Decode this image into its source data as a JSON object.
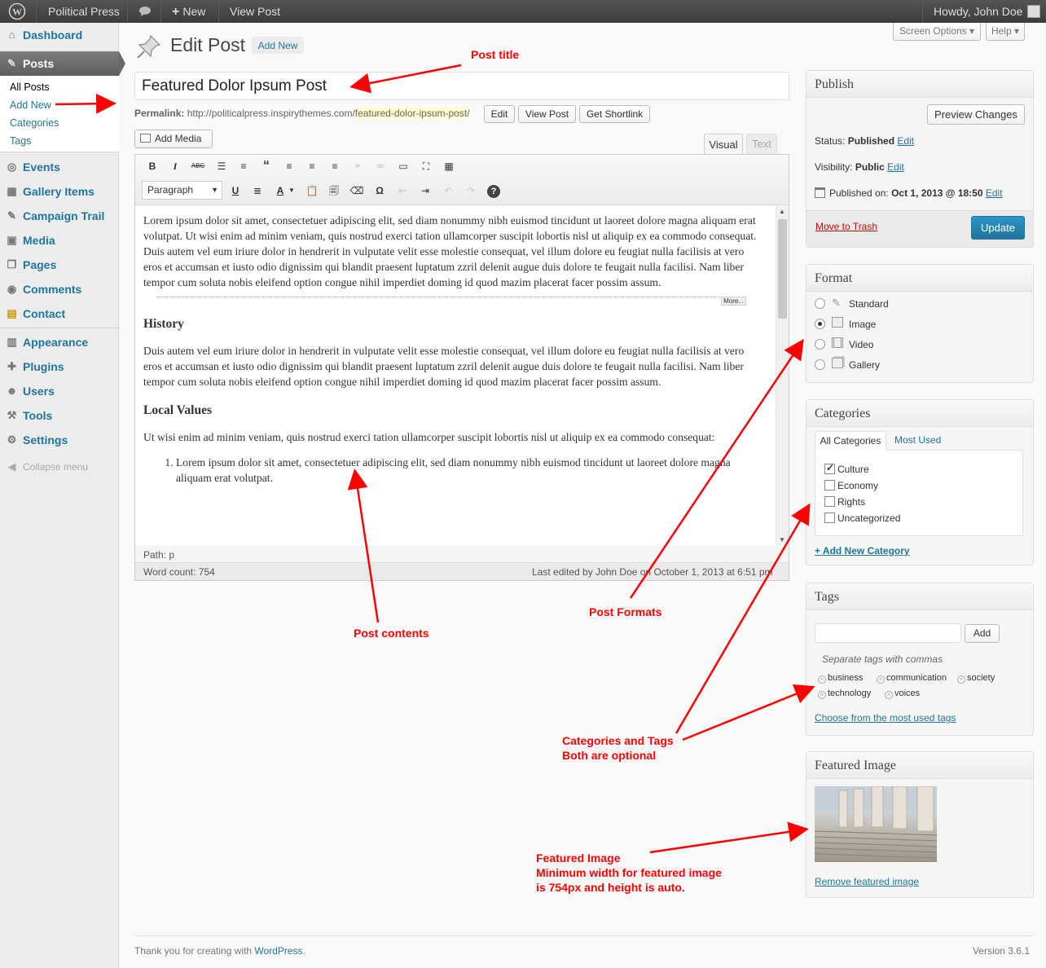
{
  "adminbar": {
    "site": "Political Press",
    "new": "New",
    "view_post": "View Post",
    "howdy": "Howdy, John Doe"
  },
  "sidebar": {
    "items": [
      {
        "label": "Dashboard",
        "icon": "dashboard-icon"
      },
      {
        "label": "Posts",
        "icon": "pin-icon"
      },
      {
        "label": "Events",
        "icon": "events-icon"
      },
      {
        "label": "Gallery Items",
        "icon": "gallery-icon"
      },
      {
        "label": "Campaign Trail",
        "icon": "pin-icon"
      },
      {
        "label": "Media",
        "icon": "media-icon"
      },
      {
        "label": "Pages",
        "icon": "pages-icon"
      },
      {
        "label": "Comments",
        "icon": "comment-icon"
      },
      {
        "label": "Contact",
        "icon": "contact-icon"
      },
      {
        "label": "Appearance",
        "icon": "appearance-icon"
      },
      {
        "label": "Plugins",
        "icon": "plugin-icon"
      },
      {
        "label": "Users",
        "icon": "users-icon"
      },
      {
        "label": "Tools",
        "icon": "tools-icon"
      },
      {
        "label": "Settings",
        "icon": "settings-icon"
      }
    ],
    "posts_sub": [
      "All Posts",
      "Add New",
      "Categories",
      "Tags"
    ],
    "collapse": "Collapse menu"
  },
  "header": {
    "screen_options": "Screen Options",
    "help": "Help",
    "title": "Edit Post",
    "add_new": "Add New"
  },
  "post": {
    "title": "Featured Dolor Ipsum Post",
    "permalink_label": "Permalink:",
    "permalink_base": "http://politicalpress.inspirythemes.com/",
    "permalink_slug": "featured-dolor-ipsum-post",
    "permalink_end": "/",
    "edit": "Edit",
    "view_post": "View Post",
    "get_shortlink": "Get Shortlink"
  },
  "editor": {
    "add_media": "Add Media",
    "tab_visual": "Visual",
    "tab_text": "Text",
    "format": "Paragraph",
    "more": "More...",
    "p1": "Lorem ipsum dolor sit amet, consectetuer adipiscing elit, sed diam nonummy nibh euismod tincidunt ut laoreet dolore magna aliquam erat volutpat. Ut wisi enim ad minim veniam, quis nostrud exerci tation ullamcorper suscipit lobortis nisl ut aliquip ex ea commodo consequat. Duis autem vel eum iriure dolor in hendrerit in vulputate velit esse molestie consequat, vel illum dolore eu feugiat nulla facilisis at vero eros et accumsan et iusto odio dignissim qui blandit praesent luptatum zzril delenit augue duis dolore te feugait nulla facilisi. Nam liber tempor cum soluta nobis eleifend option congue nihil imperdiet doming id quod mazim placerat facer possim assum.",
    "h1": "History",
    "p2": "Duis autem vel eum iriure dolor in hendrerit in vulputate velit esse molestie consequat, vel illum dolore eu feugiat nulla facilisis at vero eros et accumsan et iusto odio dignissim qui blandit praesent luptatum zzril delenit augue duis dolore te feugait nulla facilisi. Nam liber tempor cum soluta nobis eleifend option congue nihil imperdiet doming id quod mazim placerat facer possim assum.",
    "h2": "Local Values",
    "p3": "Ut wisi enim ad minim veniam, quis nostrud exerci tation ullamcorper suscipit lobortis nisl ut aliquip ex ea commodo consequat:",
    "li1": "Lorem ipsum dolor sit amet, consectetuer adipiscing elit, sed diam nonummy nibh euismod tincidunt ut laoreet dolore magna aliquam erat volutpat.",
    "path": "Path: p",
    "word_count": "Word count: 754",
    "last_edited": "Last edited by John Doe on October 1, 2013 at 6:51 pm"
  },
  "publish": {
    "title": "Publish",
    "preview": "Preview Changes",
    "status_label": "Status:",
    "status": "Published",
    "visibility_label": "Visibility:",
    "visibility": "Public",
    "published_label": "Published on:",
    "published_on": "Oct 1, 2013 @ 18:50",
    "edit": "Edit",
    "trash": "Move to Trash",
    "update": "Update"
  },
  "format": {
    "title": "Format",
    "options": [
      "Standard",
      "Image",
      "Video",
      "Gallery"
    ],
    "selected": "Image"
  },
  "categories": {
    "title": "Categories",
    "tab_all": "All Categories",
    "tab_used": "Most Used",
    "items": [
      "Culture",
      "Economy",
      "Rights",
      "Uncategorized"
    ],
    "checked": "Culture",
    "add_new": "+ Add New Category"
  },
  "tags": {
    "title": "Tags",
    "add": "Add",
    "hint": "Separate tags with commas",
    "items": [
      "business",
      "communication",
      "society",
      "technology",
      "voices"
    ],
    "choose": "Choose from the most used tags"
  },
  "featured": {
    "title": "Featured Image",
    "remove": "Remove featured image"
  },
  "annotations": {
    "post_title": "Post title",
    "post_contents": "Post contents",
    "post_formats": "Post Formats",
    "cat_tags_1": "Categories and Tags",
    "cat_tags_2": "Both are optional",
    "feat_1": "Featured Image",
    "feat_2": "Minimum width for featured image",
    "feat_3": "is 754px and height is auto."
  },
  "footer": {
    "thanks": "Thank you for creating with ",
    "wp": "WordPress",
    "dot": ".",
    "version": "Version 3.6.1"
  },
  "colors": {
    "link": "#21759b",
    "annotation": "#ff0000",
    "update_button": "#2a95c5"
  }
}
